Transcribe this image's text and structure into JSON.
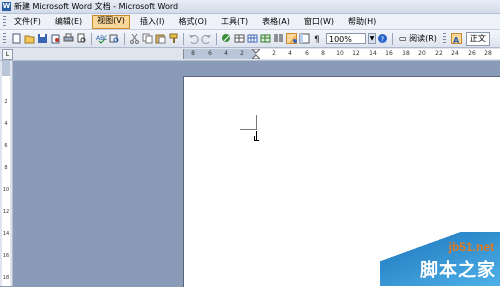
{
  "window": {
    "title": "新建 Microsoft Word 文档 - Microsoft Word"
  },
  "menubar": {
    "items": [
      {
        "label": "文件(F)"
      },
      {
        "label": "编辑(E)"
      },
      {
        "label": "视图(V)",
        "active": true
      },
      {
        "label": "插入(I)"
      },
      {
        "label": "格式(O)"
      },
      {
        "label": "工具(T)"
      },
      {
        "label": "表格(A)"
      },
      {
        "label": "窗口(W)"
      },
      {
        "label": "帮助(H)"
      }
    ]
  },
  "toolbar": {
    "zoom_value": "100%",
    "read_label": "阅读(R)",
    "style_value": "正文",
    "icons": [
      "new-icon",
      "open-icon",
      "save-icon",
      "permission-icon",
      "print-icon",
      "print-preview-icon",
      "spelling-icon",
      "research-icon",
      "cut-icon",
      "copy-icon",
      "paste-icon",
      "format-painter-icon",
      "undo-icon",
      "redo-icon",
      "hyperlink-icon",
      "tables-borders-icon",
      "insert-table-icon",
      "insert-excel-icon",
      "columns-icon",
      "drawing-icon",
      "document-map-icon",
      "show-hide-icon",
      "help-icon"
    ]
  },
  "ruler": {
    "corner_label": "L",
    "h_ticks": [
      "8",
      "6",
      "4",
      "2",
      "2",
      "4",
      "6",
      "8",
      "10",
      "12",
      "14",
      "16",
      "18",
      "20",
      "22",
      "24",
      "26",
      "28"
    ],
    "v_ticks": [
      "2",
      "4",
      "6",
      "8",
      "10",
      "12",
      "14",
      "16",
      "18"
    ]
  },
  "watermark": {
    "site": "jb51.net",
    "name": "脚本之家"
  },
  "colors": {
    "workspace": "#8a9bb8",
    "menu_active": "#fbd79a",
    "watermark_blue": "#2b87c9",
    "watermark_orange": "#e27a1e"
  }
}
